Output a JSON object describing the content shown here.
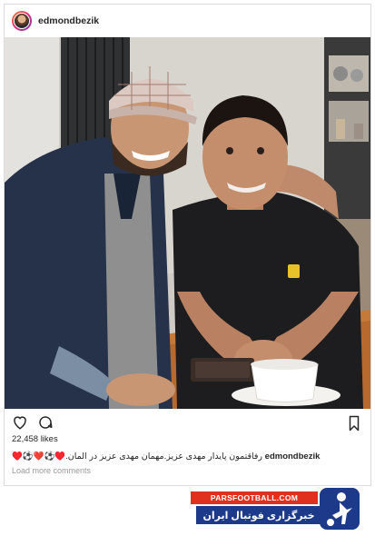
{
  "post": {
    "username": "edmondbezik",
    "likes": "22,458 likes",
    "caption_user": "edmondbezik",
    "caption_text": "رفاقتمون پایدار مهدی عزیز.مهمان مهدی عزیز در المان.♥️⚽️❤️⚽️♥️",
    "load_more": "Load more comments"
  },
  "watermark": {
    "site": "PARSFOOTBALL.COM",
    "tagline": "خبرگزاری فوتبال ایران"
  },
  "icons": [
    "heart-icon",
    "comment-icon",
    "bookmark-icon"
  ]
}
